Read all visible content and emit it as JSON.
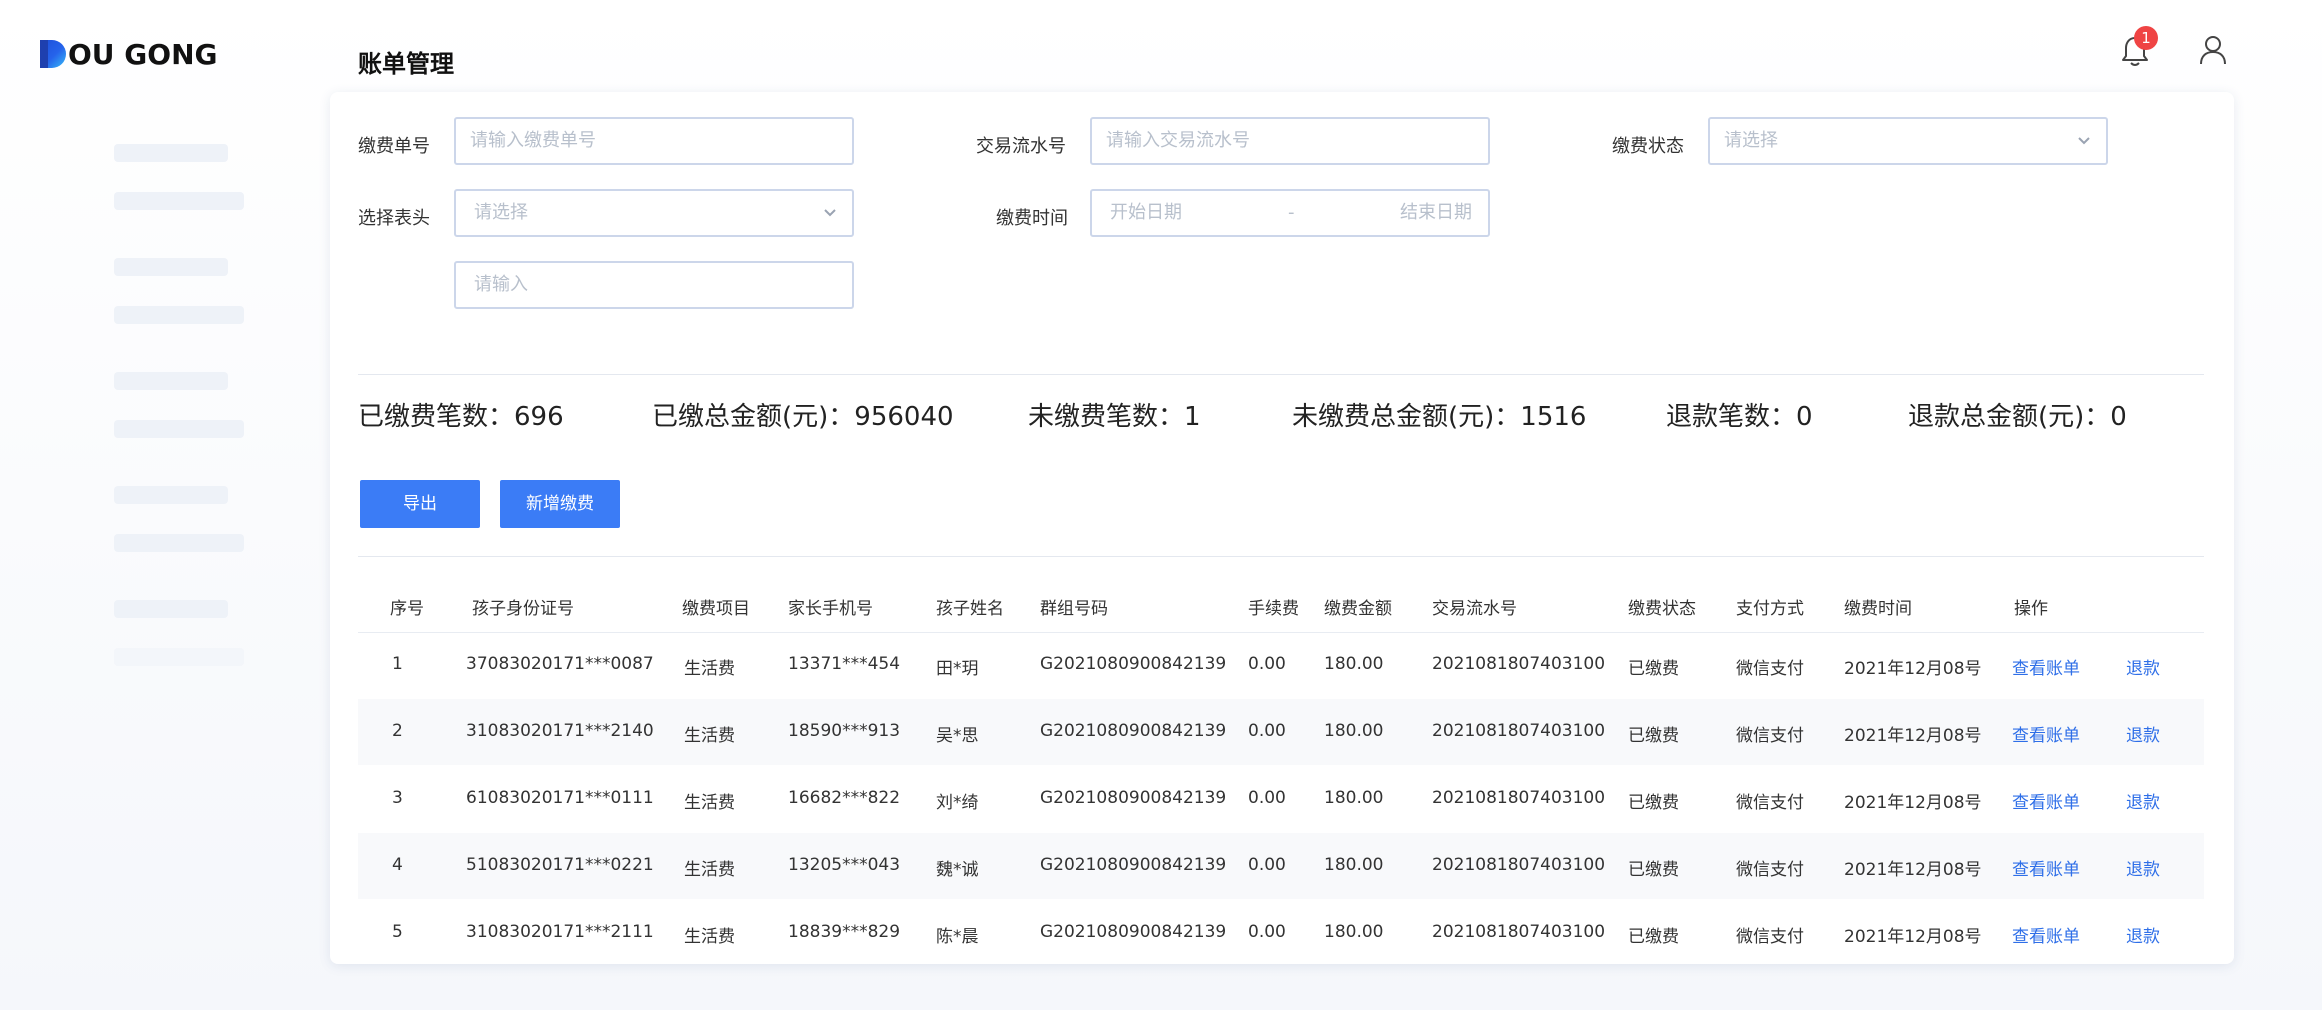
{
  "logo": {
    "text": "OU GONG",
    "mark_letter": "D"
  },
  "header": {
    "title": "账单管理",
    "notification_count": "1"
  },
  "filters": {
    "bill_no": {
      "label": "缴费单号",
      "placeholder": "请输入缴费单号"
    },
    "trade_no": {
      "label": "交易流水号",
      "placeholder": "请输入交易流水号"
    },
    "status": {
      "label": "缴费状态",
      "placeholder": "请选择"
    },
    "header_select": {
      "label": "选择表头",
      "placeholder": "请选择"
    },
    "header_input": {
      "placeholder": "请输入"
    },
    "pay_time": {
      "label": "缴费时间",
      "start_placeholder": "开始日期",
      "separator": "-",
      "end_placeholder": "结束日期"
    }
  },
  "stats": {
    "paid_count": "已缴费笔数：696",
    "paid_amount": "已缴总金额(元)：956040",
    "unpaid_count": "未缴费笔数：1",
    "unpaid_amount": "未缴费总金额(元)：1516",
    "refund_count": "退款笔数：0",
    "refund_amount": "退款总金额(元)：0"
  },
  "actions": {
    "export_label": "导出",
    "add_label": "新增缴费"
  },
  "table": {
    "columns": [
      "序号",
      "孩子身份证号",
      "缴费项目",
      "家长手机号",
      "孩子姓名",
      "群组号码",
      "手续费",
      "缴费金额",
      "交易流水号",
      "缴费状态",
      "支付方式",
      "缴费时间",
      "操作"
    ],
    "rows": [
      {
        "no": "1",
        "id_card": "37083020171***0087",
        "item": "生活费",
        "phone": "13371***454",
        "name": "田*玥",
        "group": "G2021080900842139",
        "fee": "0.00",
        "amount": "180.00",
        "trade_no": "2021081807403100",
        "status": "已缴费",
        "method": "微信支付",
        "time": "2021年12月08号",
        "view": "查看账单",
        "refund": "退款"
      },
      {
        "no": "2",
        "id_card": "31083020171***2140",
        "item": "生活费",
        "phone": "18590***913",
        "name": "吴*思",
        "group": "G2021080900842139",
        "fee": "0.00",
        "amount": "180.00",
        "trade_no": "2021081807403100",
        "status": "已缴费",
        "method": "微信支付",
        "time": "2021年12月08号",
        "view": "查看账单",
        "refund": "退款"
      },
      {
        "no": "3",
        "id_card": "61083020171***0111",
        "item": "生活费",
        "phone": "16682***822",
        "name": "刘*绮",
        "group": "G2021080900842139",
        "fee": "0.00",
        "amount": "180.00",
        "trade_no": "2021081807403100",
        "status": "已缴费",
        "method": "微信支付",
        "time": "2021年12月08号",
        "view": "查看账单",
        "refund": "退款"
      },
      {
        "no": "4",
        "id_card": "51083020171***0221",
        "item": "生活费",
        "phone": "13205***043",
        "name": "魏*诚",
        "group": "G2021080900842139",
        "fee": "0.00",
        "amount": "180.00",
        "trade_no": "2021081807403100",
        "status": "已缴费",
        "method": "微信支付",
        "time": "2021年12月08号",
        "view": "查看账单",
        "refund": "退款"
      },
      {
        "no": "5",
        "id_card": "31083020171***2111",
        "item": "生活费",
        "phone": "18839***829",
        "name": "陈*晨",
        "group": "G2021080900842139",
        "fee": "0.00",
        "amount": "180.00",
        "trade_no": "2021081807403100",
        "status": "已缴费",
        "method": "微信支付",
        "time": "2021年12月08号",
        "view": "查看账单",
        "refund": "退款"
      }
    ]
  },
  "colors": {
    "primary": "#3b7cf6",
    "link": "#2f6fe8",
    "badge": "#ef4444",
    "border": "#ccd6ea"
  }
}
